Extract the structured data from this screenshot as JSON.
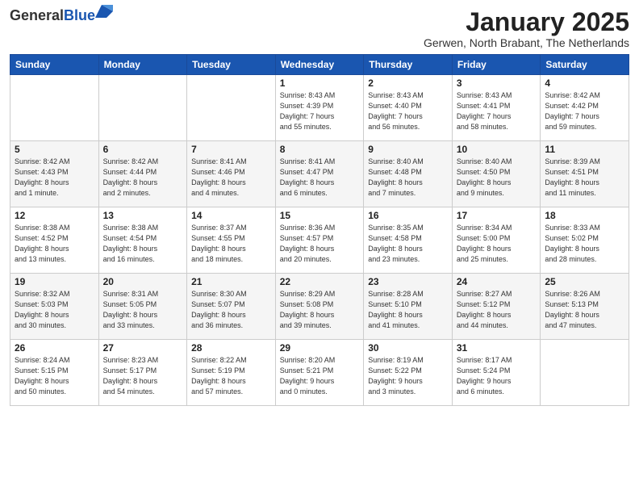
{
  "header": {
    "logo_general": "General",
    "logo_blue": "Blue",
    "month_title": "January 2025",
    "location": "Gerwen, North Brabant, The Netherlands"
  },
  "weekdays": [
    "Sunday",
    "Monday",
    "Tuesday",
    "Wednesday",
    "Thursday",
    "Friday",
    "Saturday"
  ],
  "weeks": [
    [
      {
        "day": "",
        "info": ""
      },
      {
        "day": "",
        "info": ""
      },
      {
        "day": "",
        "info": ""
      },
      {
        "day": "1",
        "info": "Sunrise: 8:43 AM\nSunset: 4:39 PM\nDaylight: 7 hours\nand 55 minutes."
      },
      {
        "day": "2",
        "info": "Sunrise: 8:43 AM\nSunset: 4:40 PM\nDaylight: 7 hours\nand 56 minutes."
      },
      {
        "day": "3",
        "info": "Sunrise: 8:43 AM\nSunset: 4:41 PM\nDaylight: 7 hours\nand 58 minutes."
      },
      {
        "day": "4",
        "info": "Sunrise: 8:42 AM\nSunset: 4:42 PM\nDaylight: 7 hours\nand 59 minutes."
      }
    ],
    [
      {
        "day": "5",
        "info": "Sunrise: 8:42 AM\nSunset: 4:43 PM\nDaylight: 8 hours\nand 1 minute."
      },
      {
        "day": "6",
        "info": "Sunrise: 8:42 AM\nSunset: 4:44 PM\nDaylight: 8 hours\nand 2 minutes."
      },
      {
        "day": "7",
        "info": "Sunrise: 8:41 AM\nSunset: 4:46 PM\nDaylight: 8 hours\nand 4 minutes."
      },
      {
        "day": "8",
        "info": "Sunrise: 8:41 AM\nSunset: 4:47 PM\nDaylight: 8 hours\nand 6 minutes."
      },
      {
        "day": "9",
        "info": "Sunrise: 8:40 AM\nSunset: 4:48 PM\nDaylight: 8 hours\nand 7 minutes."
      },
      {
        "day": "10",
        "info": "Sunrise: 8:40 AM\nSunset: 4:50 PM\nDaylight: 8 hours\nand 9 minutes."
      },
      {
        "day": "11",
        "info": "Sunrise: 8:39 AM\nSunset: 4:51 PM\nDaylight: 8 hours\nand 11 minutes."
      }
    ],
    [
      {
        "day": "12",
        "info": "Sunrise: 8:38 AM\nSunset: 4:52 PM\nDaylight: 8 hours\nand 13 minutes."
      },
      {
        "day": "13",
        "info": "Sunrise: 8:38 AM\nSunset: 4:54 PM\nDaylight: 8 hours\nand 16 minutes."
      },
      {
        "day": "14",
        "info": "Sunrise: 8:37 AM\nSunset: 4:55 PM\nDaylight: 8 hours\nand 18 minutes."
      },
      {
        "day": "15",
        "info": "Sunrise: 8:36 AM\nSunset: 4:57 PM\nDaylight: 8 hours\nand 20 minutes."
      },
      {
        "day": "16",
        "info": "Sunrise: 8:35 AM\nSunset: 4:58 PM\nDaylight: 8 hours\nand 23 minutes."
      },
      {
        "day": "17",
        "info": "Sunrise: 8:34 AM\nSunset: 5:00 PM\nDaylight: 8 hours\nand 25 minutes."
      },
      {
        "day": "18",
        "info": "Sunrise: 8:33 AM\nSunset: 5:02 PM\nDaylight: 8 hours\nand 28 minutes."
      }
    ],
    [
      {
        "day": "19",
        "info": "Sunrise: 8:32 AM\nSunset: 5:03 PM\nDaylight: 8 hours\nand 30 minutes."
      },
      {
        "day": "20",
        "info": "Sunrise: 8:31 AM\nSunset: 5:05 PM\nDaylight: 8 hours\nand 33 minutes."
      },
      {
        "day": "21",
        "info": "Sunrise: 8:30 AM\nSunset: 5:07 PM\nDaylight: 8 hours\nand 36 minutes."
      },
      {
        "day": "22",
        "info": "Sunrise: 8:29 AM\nSunset: 5:08 PM\nDaylight: 8 hours\nand 39 minutes."
      },
      {
        "day": "23",
        "info": "Sunrise: 8:28 AM\nSunset: 5:10 PM\nDaylight: 8 hours\nand 41 minutes."
      },
      {
        "day": "24",
        "info": "Sunrise: 8:27 AM\nSunset: 5:12 PM\nDaylight: 8 hours\nand 44 minutes."
      },
      {
        "day": "25",
        "info": "Sunrise: 8:26 AM\nSunset: 5:13 PM\nDaylight: 8 hours\nand 47 minutes."
      }
    ],
    [
      {
        "day": "26",
        "info": "Sunrise: 8:24 AM\nSunset: 5:15 PM\nDaylight: 8 hours\nand 50 minutes."
      },
      {
        "day": "27",
        "info": "Sunrise: 8:23 AM\nSunset: 5:17 PM\nDaylight: 8 hours\nand 54 minutes."
      },
      {
        "day": "28",
        "info": "Sunrise: 8:22 AM\nSunset: 5:19 PM\nDaylight: 8 hours\nand 57 minutes."
      },
      {
        "day": "29",
        "info": "Sunrise: 8:20 AM\nSunset: 5:21 PM\nDaylight: 9 hours\nand 0 minutes."
      },
      {
        "day": "30",
        "info": "Sunrise: 8:19 AM\nSunset: 5:22 PM\nDaylight: 9 hours\nand 3 minutes."
      },
      {
        "day": "31",
        "info": "Sunrise: 8:17 AM\nSunset: 5:24 PM\nDaylight: 9 hours\nand 6 minutes."
      },
      {
        "day": "",
        "info": ""
      }
    ]
  ]
}
